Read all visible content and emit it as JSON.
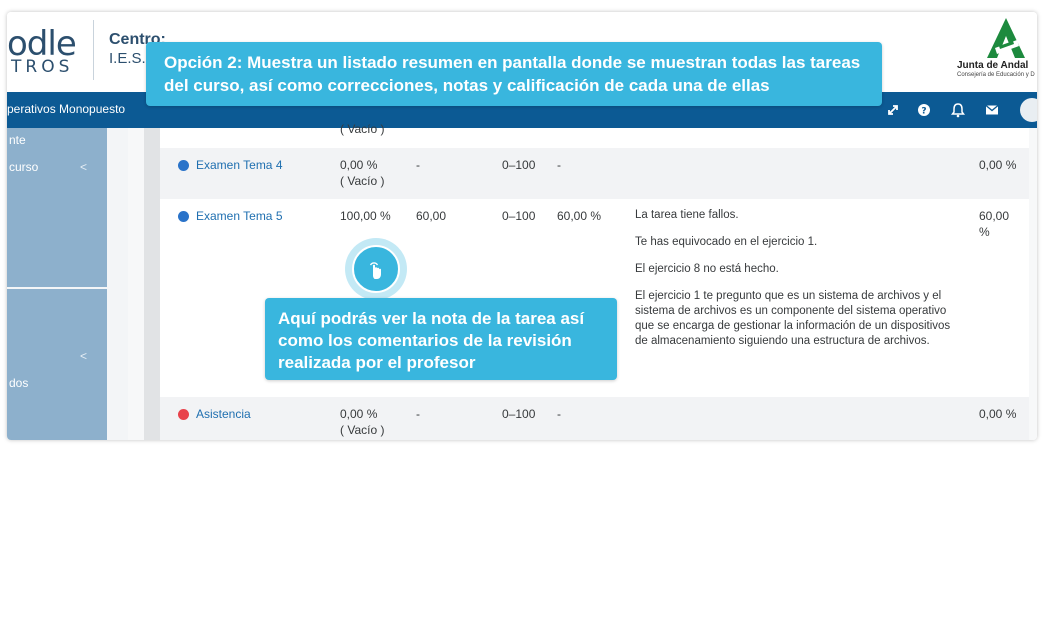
{
  "header": {
    "logo_text": "odle",
    "logo_sub": "TROS",
    "centro_label": "Centro:",
    "centro_value": "I.E.S.",
    "junta_name": "Junta de Andal",
    "junta_sub": "Consejería de Educación y D"
  },
  "navbar": {
    "course_name": "perativos Monopuesto",
    "icons": [
      "expand-icon",
      "help-icon",
      "bell-icon",
      "mail-icon",
      "user-avatar"
    ]
  },
  "sidebar": {
    "items": [
      {
        "label": "nte"
      },
      {
        "label": "curso",
        "chevron": "<"
      },
      {
        "label": "",
        "chevron": "<"
      },
      {
        "label": "dos"
      }
    ]
  },
  "grades": {
    "prev_row_tail": "( Vacío )",
    "rows": [
      {
        "item": "Examen Tema 4",
        "type": "assign",
        "calc_weight": "0,00 %",
        "calc_weight_sub": "( Vacío )",
        "grade": "-",
        "range": "0–100",
        "percentage": "-",
        "feedback": [],
        "contribution": "0,00 %"
      },
      {
        "item": "Examen Tema 5",
        "type": "assign",
        "calc_weight": "100,00 %",
        "calc_weight_sub": "",
        "grade": "60,00",
        "range": "0–100",
        "percentage": "60,00 %",
        "feedback": [
          "La tarea tiene fallos.",
          "Te has equivocado en el ejercicio 1.",
          "El ejercicio 8 no está hecho.",
          "El ejercicio 1 te pregunto que es un sistema de archivos y el sistema de archivos es un componente del sistema operativo que se encarga de gestionar la información de un dispositivos de almacenamiento siguiendo una estructura de archivos."
        ],
        "contribution": "60,00 %"
      },
      {
        "item": "Asistencia",
        "type": "attendance",
        "calc_weight": "0,00 %",
        "calc_weight_sub": "( Vacío )",
        "grade": "-",
        "range": "0–100",
        "percentage": "-",
        "feedback": [],
        "contribution": "0,00 %"
      }
    ]
  },
  "callouts": {
    "top": "Opción 2: Muestra un listado resumen en pantalla donde se muestran todas las tareas del curso, así como correcciones, notas y calificación de cada una de ellas",
    "mid": "Aquí podrás ver la nota de la tarea así como los comentarios de la revisión realizada por el profesor"
  },
  "colors": {
    "navbar": "#0c5a94",
    "callout": "#39b6de",
    "sidebar_panel": "#8db0cc",
    "link": "#1f6fb0",
    "assign_icon": "#2a73c9",
    "attendance_icon": "#e8424b"
  }
}
